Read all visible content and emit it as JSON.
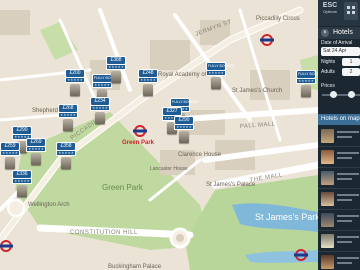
{
  "toolbar": {
    "esc_label": "ESC",
    "esc_sub": "Options"
  },
  "hotels_panel": {
    "title": "Hotels",
    "close_glyph": "×",
    "date_label": "Date of Arrival",
    "date_value": "Sat 24 Apr",
    "nights_label": "Nights",
    "nights_value": "1",
    "adults_label": "Adults",
    "adults_value": "2",
    "prices_label": "Prices",
    "results_header": "Hotels on map"
  },
  "map": {
    "places": [
      "Piccadilly Circus",
      "Royal Academy of Arts",
      "St James's Church",
      "Shepherd Market",
      "Green Park",
      "St James's Palace",
      "Clarence House",
      "Lancaster House",
      "Wellington Arch",
      "St James's Park",
      "Buckingham Palace"
    ],
    "roads": [
      "PICCADILLY",
      "PALL MALL",
      "THE MALL",
      "CONSTITUTION HILL",
      "JERMYN ST"
    ],
    "stations": [
      "Green Park"
    ]
  },
  "pins": [
    {
      "price": "£200"
    },
    {
      "price": "FULLY BOOKED"
    },
    {
      "price": "£248"
    },
    {
      "price": "£388"
    },
    {
      "price": "FULLY BOOKED"
    },
    {
      "price": "£268"
    },
    {
      "price": "£234"
    },
    {
      "price": "FULLY BOOKED"
    },
    {
      "price": "£327"
    },
    {
      "price": "£290"
    },
    {
      "price": "£290"
    },
    {
      "price": "£269"
    },
    {
      "price": "£259"
    },
    {
      "price": "£358"
    },
    {
      "price": "£336"
    },
    {
      "price": "FULLY BOOKED"
    }
  ],
  "stars_glyph": "★★★★★",
  "colors": {
    "pin_blue": "#1f5c94",
    "park_green": "#bfd9a0",
    "water_blue": "#7fb8d8",
    "panel_dark": "#1b2731",
    "header_blue": "#3b6f97"
  }
}
